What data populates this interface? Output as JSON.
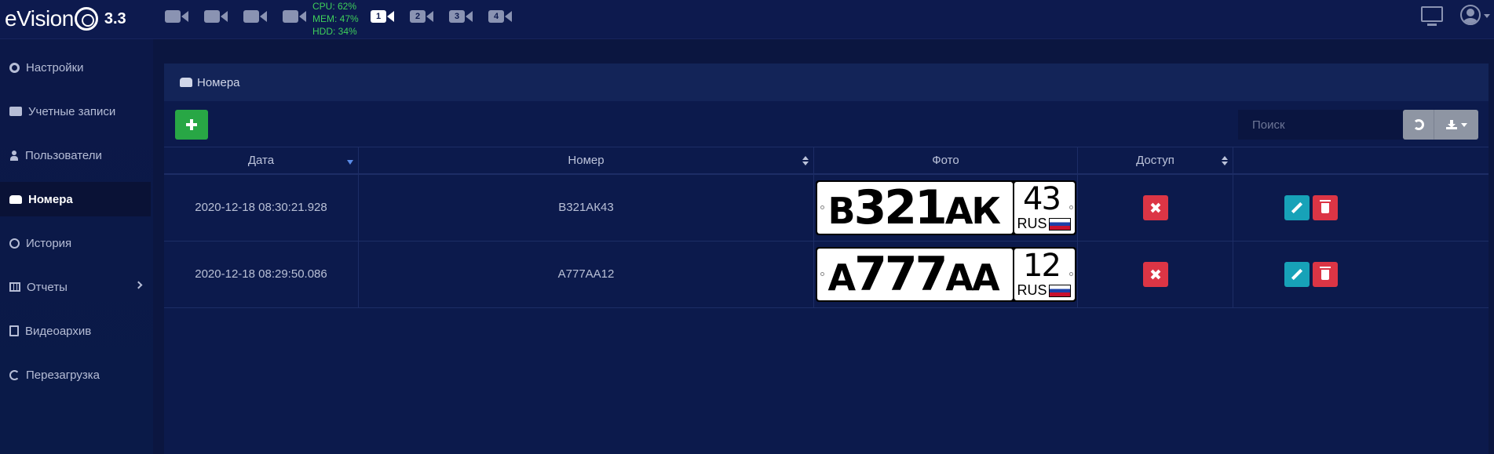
{
  "app": {
    "brand": "eVision",
    "version": "3.3"
  },
  "toolbar": {
    "layouts": [
      {
        "name": "camera-search",
        "label": ""
      },
      {
        "name": "camera-refresh",
        "label": ""
      },
      {
        "name": "camera-add",
        "label": ""
      },
      {
        "name": "camera-remove",
        "label": ""
      },
      {
        "name": "layout-1",
        "label": "1"
      },
      {
        "name": "layout-2",
        "label": "2"
      },
      {
        "name": "layout-3",
        "label": "3"
      },
      {
        "name": "layout-4",
        "label": "4"
      }
    ],
    "active_layout": "1"
  },
  "stats": {
    "cpu": "CPU: 62%",
    "mem": "MEM: 47%",
    "hdd": "HDD: 34%"
  },
  "sidebar": {
    "items": [
      {
        "label": "Настройки",
        "icon": "gear-icon"
      },
      {
        "label": "Учетные записи",
        "icon": "id-card-icon"
      },
      {
        "label": "Пользователи",
        "icon": "user-icon"
      },
      {
        "label": "Номера",
        "icon": "car-icon",
        "active": true
      },
      {
        "label": "История",
        "icon": "history-icon"
      },
      {
        "label": "Отчеты",
        "icon": "table-icon"
      },
      {
        "label": "Видеоархив",
        "icon": "video-file-icon"
      },
      {
        "label": "Перезагрузка",
        "icon": "refresh-icon"
      }
    ]
  },
  "panel": {
    "title": "Номера",
    "search_placeholder": "Поиск",
    "columns": {
      "date": "Дата",
      "number": "Номер",
      "photo": "Фото",
      "access": "Доступ"
    },
    "rows": [
      {
        "date": "2020-12-18 08:30:21.928",
        "number": "В321АК43",
        "plate_first": "В",
        "plate_digits": "321",
        "plate_letters": "АК",
        "region": "43",
        "country": "RUS"
      },
      {
        "date": "2020-12-18 08:29:50.086",
        "number": "А777АА12",
        "plate_first": "А",
        "plate_digits": "777",
        "plate_letters": "АА",
        "region": "12",
        "country": "RUS"
      }
    ]
  },
  "colors": {
    "background": "#0b1640",
    "panel": "#0c1a4c",
    "add": "#28a745",
    "danger": "#dc3545",
    "info": "#17a2b8",
    "stats": "#3ecf5a"
  }
}
